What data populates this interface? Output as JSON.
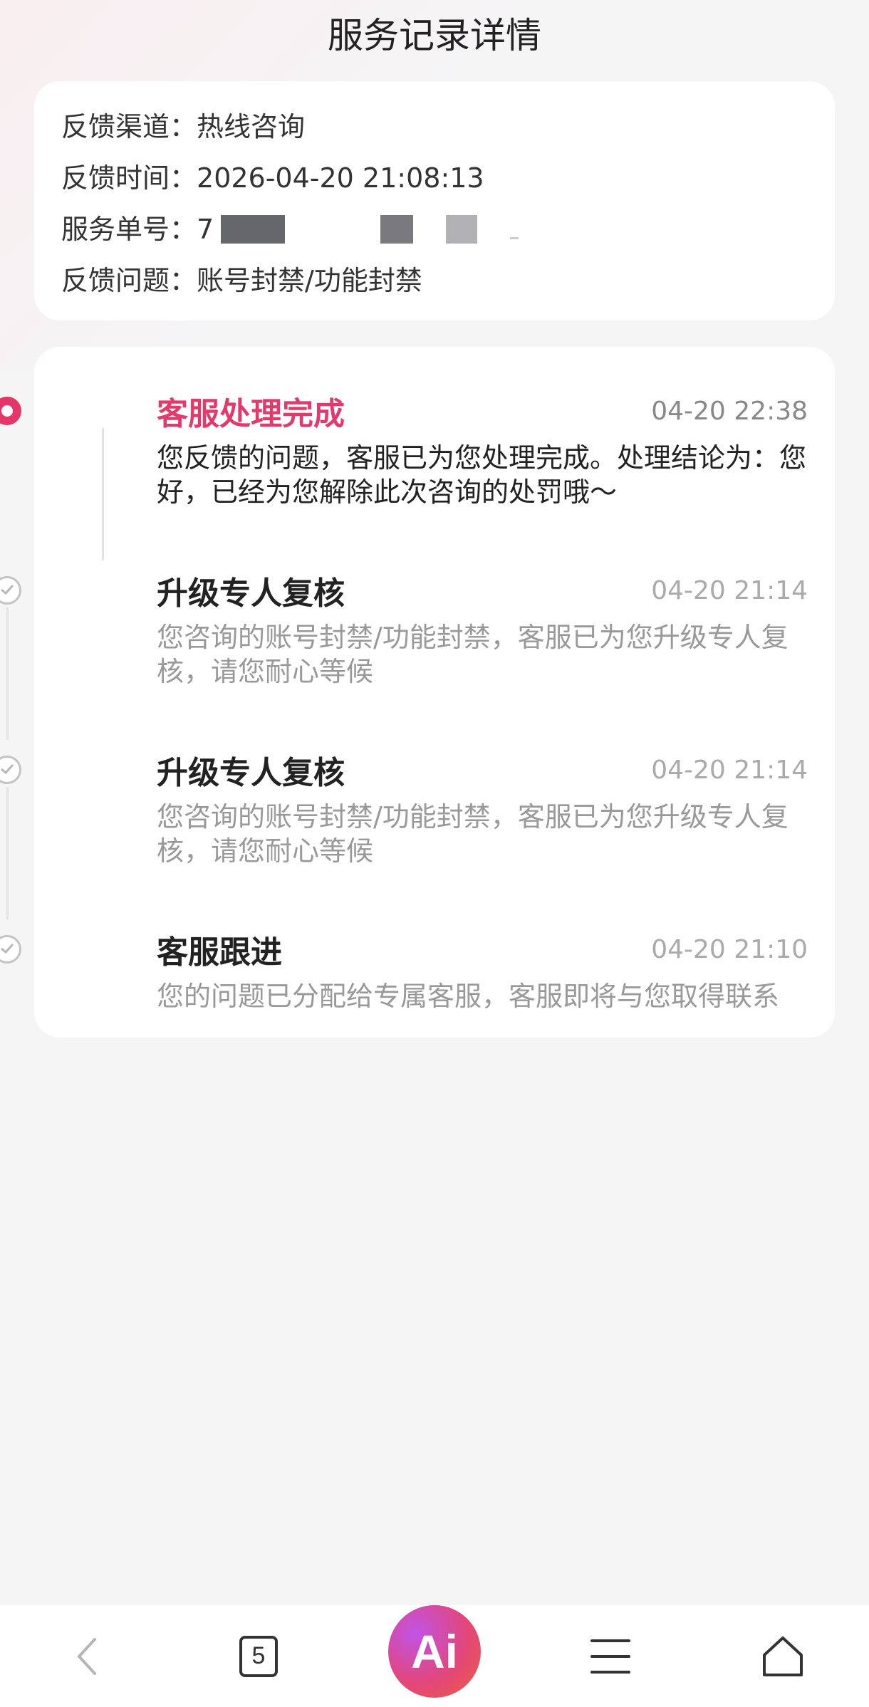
{
  "page": {
    "title": "服务记录详情"
  },
  "info": {
    "channel_label": "反馈渠道：",
    "channel_value": "热线咨询",
    "time_label": "反馈时间：",
    "time_value": "2026-04-20 21:08:13",
    "order_label": "服务单号：",
    "order_value_prefix": "7",
    "issue_label": "反馈问题：",
    "issue_value": "账号封禁/功能封禁"
  },
  "timeline": [
    {
      "title": "客服处理完成",
      "time": "04-20 22:38",
      "desc": "您反馈的问题，客服已为您处理完成。处理结论为：您好，已经为您解除此次咨询的处罚哦～",
      "status": "active"
    },
    {
      "title": "升级专人复核",
      "time": "04-20 21:14",
      "desc": "您咨询的账号封禁/功能封禁，客服已为您升级专人复核，请您耐心等候",
      "status": "done"
    },
    {
      "title": "升级专人复核",
      "time": "04-20 21:14",
      "desc": "您咨询的账号封禁/功能封禁，客服已为您升级专人复核，请您耐心等候",
      "status": "done"
    },
    {
      "title": "客服跟进",
      "time": "04-20 21:10",
      "desc": "您的问题已分配给专属客服，客服即将与您取得联系",
      "status": "done"
    }
  ],
  "bottom_nav": {
    "tab_count": "5",
    "ai_label": "Ai",
    "icons": [
      "back-arrow-icon",
      "tabs-icon",
      "ai-assistant-icon",
      "menu-icon",
      "home-icon"
    ]
  },
  "colors": {
    "accent": "#e5366a",
    "title_active": "#e23a6c",
    "muted": "#999999"
  }
}
